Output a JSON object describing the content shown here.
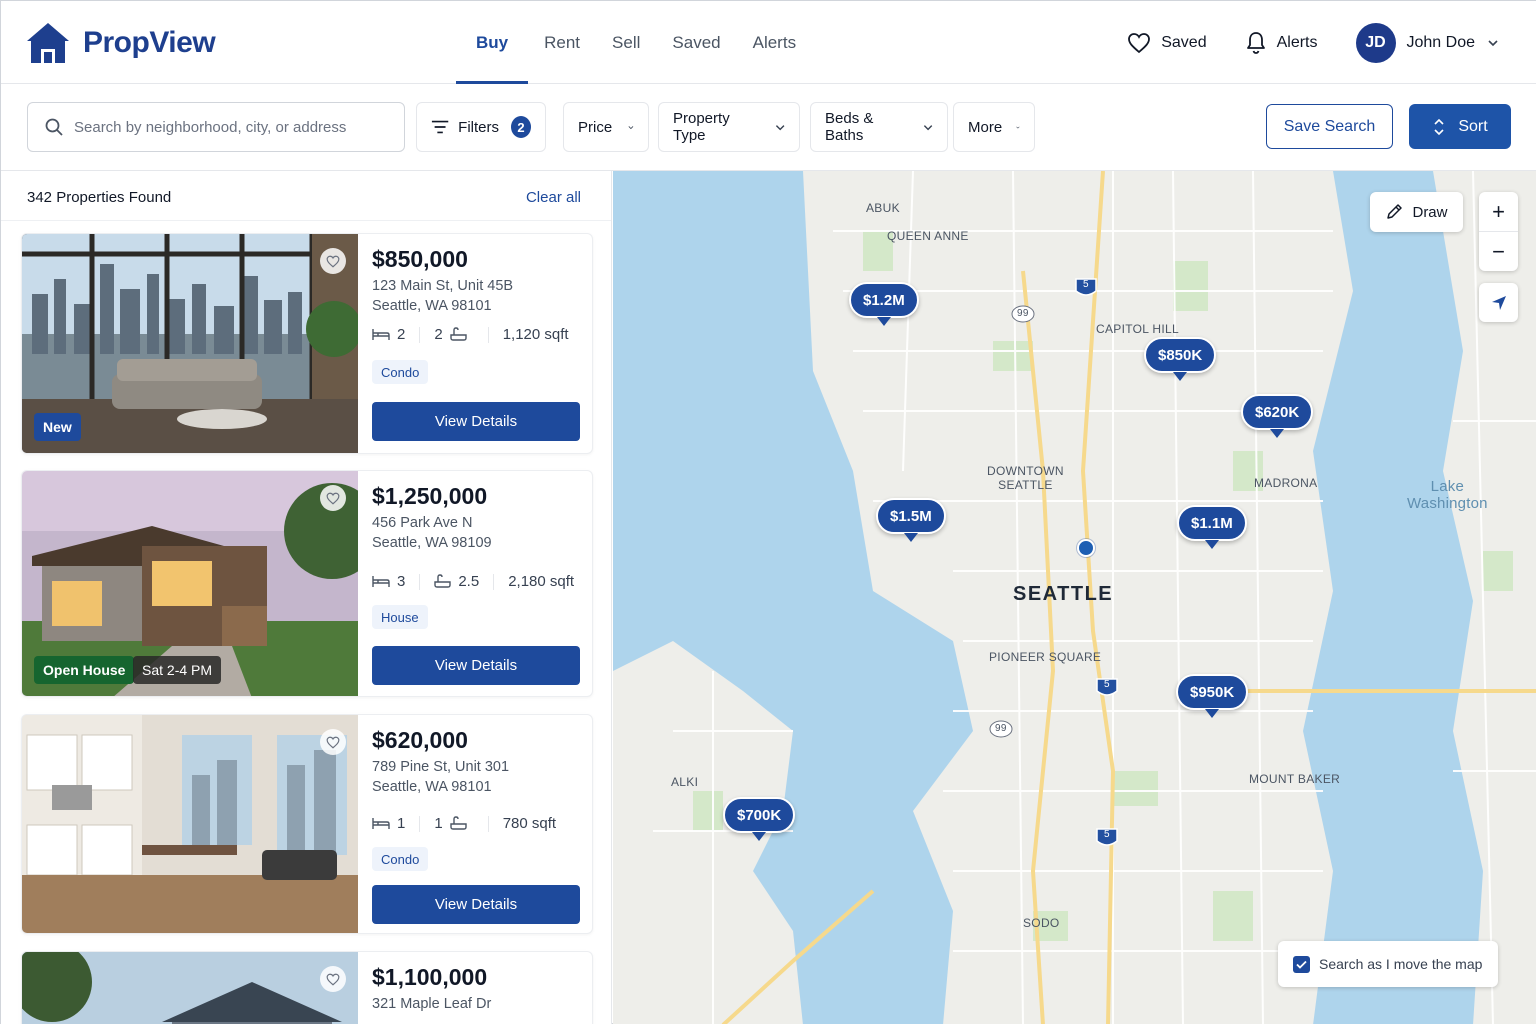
{
  "brand": {
    "name": "PropView",
    "color": "#1e3f8e"
  },
  "nav": {
    "items": [
      {
        "label": "Buy",
        "active": true
      },
      {
        "label": "Rent"
      },
      {
        "label": "Sell"
      },
      {
        "label": "Saved"
      },
      {
        "label": "Alerts"
      }
    ]
  },
  "header": {
    "saved_label": "Saved",
    "alerts_label": "Alerts",
    "user_initials": "JD",
    "user_name": "John Doe"
  },
  "filters": {
    "search_placeholder": "Search by neighborhood, city, or address",
    "filters_label": "Filters",
    "filters_count": "2",
    "price_label": "Price",
    "property_type_label": "Property Type",
    "beds_baths_label": "Beds & Baths",
    "more_label": "More",
    "save_search_label": "Save Search",
    "sort_label": "Sort"
  },
  "results": {
    "count_text": "342 Properties Found",
    "clear_all": "Clear all",
    "view_details_label": "View Details",
    "listings": [
      {
        "price": "$850,000",
        "address_line1": "123 Main St, Unit 45B",
        "address_line2": "Seattle, WA 98101",
        "beds": "2",
        "baths": "2",
        "sqft": "1,120 sqft",
        "type": "Condo",
        "badge": "New"
      },
      {
        "price": "$1,250,000",
        "address_line1": "456 Park Ave N",
        "address_line2": "Seattle, WA 98109",
        "beds": "3",
        "baths": "2.5",
        "sqft": "2,180 sqft",
        "type": "House",
        "badge": "Open House",
        "badge_time": "Sat 2-4 PM"
      },
      {
        "price": "$620,000",
        "address_line1": "789 Pine St, Unit 301",
        "address_line2": "Seattle, WA 98101",
        "beds": "1",
        "baths": "1",
        "sqft": "780 sqft",
        "type": "Condo"
      },
      {
        "price": "$1,100,000",
        "address_line1": "321 Maple Leaf Dr"
      }
    ]
  },
  "map": {
    "draw_label": "Draw",
    "zoom_in": "+",
    "zoom_out": "−",
    "search_as_move_label": "Search as I move the map",
    "search_as_move_checked": true,
    "labels": {
      "abuk": "ABUK",
      "queen_anne": "QUEEN ANNE",
      "capitol_hill": "CAPITOL HILL",
      "downtown_1": "DOWNTOWN",
      "downtown_2": "SEATTLE",
      "madrona": "MADRONA",
      "lake_1": "Lake",
      "lake_2": "Washington",
      "seattle": "SEATTLE",
      "pioneer_square": "PIONEER SQUARE",
      "alki": "ALKI",
      "mount_baker": "MOUNT BAKER",
      "sodo": "SODO",
      "route_99": "99",
      "interstate_5": "5"
    },
    "pins": [
      {
        "label": "$1.2M"
      },
      {
        "label": "$850K"
      },
      {
        "label": "$620K"
      },
      {
        "label": "$1.5M"
      },
      {
        "label": "$1.1M"
      },
      {
        "label": "$950K"
      },
      {
        "label": "$700K"
      }
    ]
  }
}
